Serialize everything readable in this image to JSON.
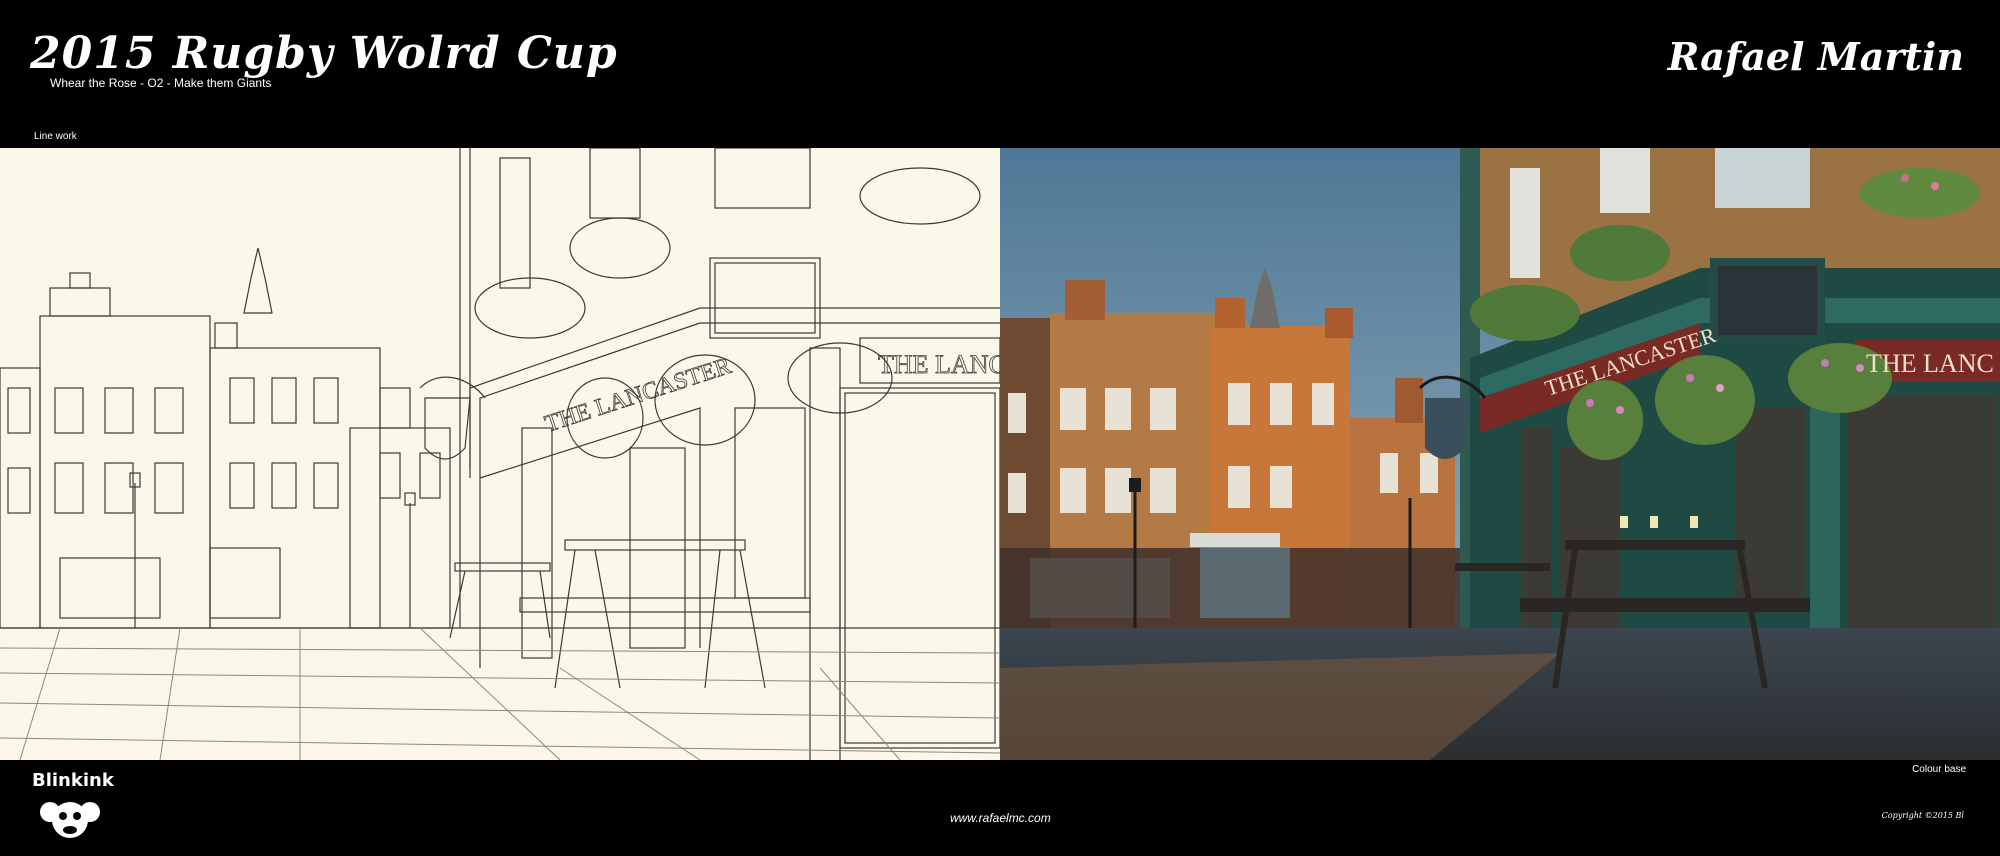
{
  "header": {
    "title": "2015 Rugby Wolrd Cup",
    "subtitle": "Whear the Rose - O2 - Make them Giants",
    "author": "Rafael Martin"
  },
  "panels": {
    "left_label": "Line work",
    "right_label": "Colour base"
  },
  "artwork": {
    "sign_left": "THE LANCASTER",
    "facade_left": "THE LANC",
    "sign_right": "THE LANCASTER",
    "facade_right": "THE LANC"
  },
  "footer": {
    "logo_text": "Blinkink",
    "website": "www.rafaelmc.com",
    "copyright": "Copyright ©2015 Bl"
  },
  "colors": {
    "background": "#000000",
    "paper": "#fbf8ea",
    "sky": "#5a84a6",
    "pub_green": "#1f4a44",
    "brick": "#c57a3a",
    "sign_red": "#7a2a24"
  }
}
